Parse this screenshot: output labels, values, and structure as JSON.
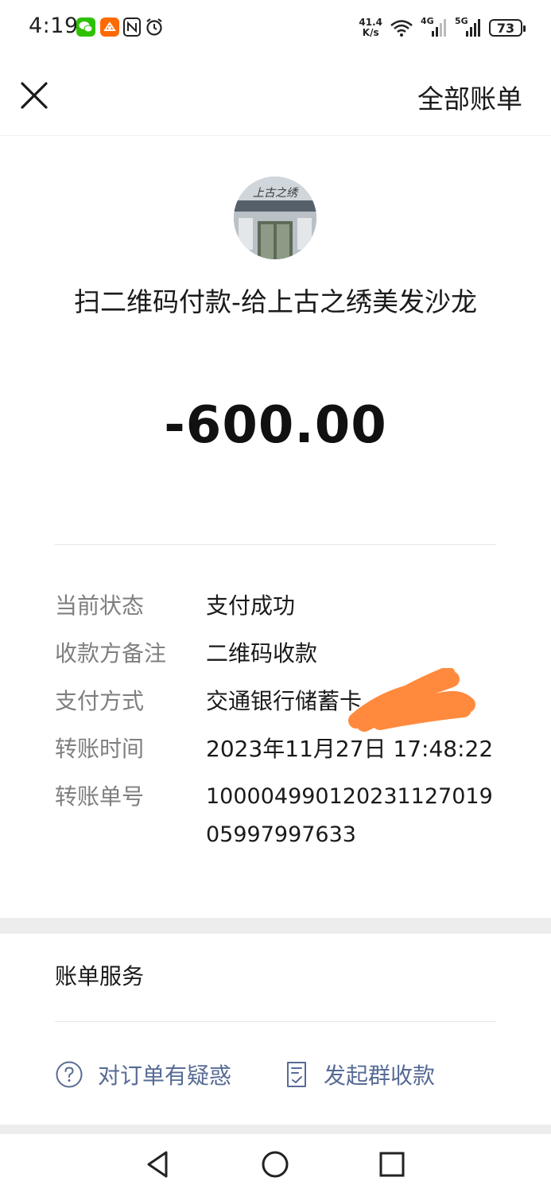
{
  "status_bar": {
    "time": "4:19",
    "net_speed_value": "41.4",
    "net_speed_unit": "K/s",
    "signal1_label": "4G",
    "signal2_label": "5G",
    "battery": "73",
    "icons": [
      "wechat-icon",
      "app-icon",
      "nfc-icon",
      "alarm-icon",
      "wifi-icon",
      "signal-icon",
      "signal-icon",
      "battery-icon"
    ]
  },
  "header": {
    "close_icon": "close-icon",
    "all_bills_label": "全部账单"
  },
  "merchant": {
    "title": "扫二维码付款-给上古之绣美发沙龙",
    "avatar_sign_text": "上古之绣",
    "amount": "-600.00"
  },
  "details": [
    {
      "label": "当前状态",
      "value": "支付成功"
    },
    {
      "label": "收款方备注",
      "value": "二维码收款"
    },
    {
      "label": "支付方式",
      "value": "交通银行储蓄卡"
    },
    {
      "label": "转账时间",
      "value": "2023年11月27日 17:48:22"
    },
    {
      "label": "转账单号",
      "value": "100004990120231127019 05997997633"
    }
  ],
  "services": {
    "title": "账单服务",
    "question_label": "对订单有疑惑",
    "group_collect_label": "发起群收款"
  },
  "colors": {
    "link": "#576b95",
    "label_gray": "#7f7f7f",
    "redaction": "#ff8a3d"
  }
}
